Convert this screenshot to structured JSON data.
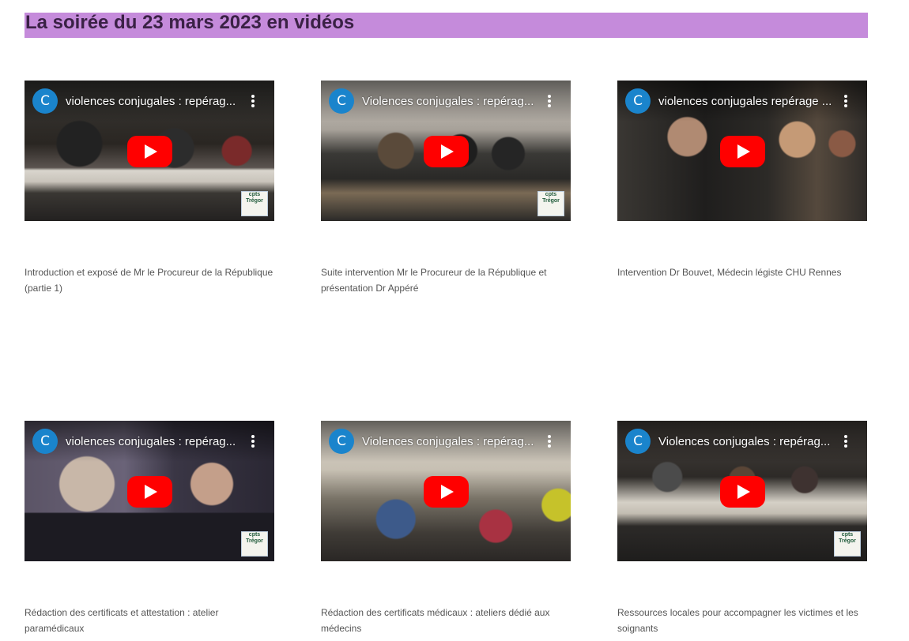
{
  "section": {
    "title": "La soirée du 23 mars 2023 en vidéos"
  },
  "videos": [
    {
      "title": "violences conjugales : repérag...",
      "channel_initial": "C",
      "logo_text": "cpts Trégor",
      "caption": "Introduction et exposé de Mr le Procureur de la République (partie 1)"
    },
    {
      "title": "Violences conjugales : repérag...",
      "channel_initial": "C",
      "logo_text": "cpts Trégor",
      "caption": "Suite intervention Mr le Procureur de la République et présentation Dr Appéré"
    },
    {
      "title": "violences conjugales repérage ...",
      "channel_initial": "C",
      "logo_text": "",
      "caption": "Intervention Dr Bouvet, Médecin légiste CHU Rennes"
    },
    {
      "title": "violences conjugales : repérag...",
      "channel_initial": "C",
      "logo_text": "cpts Trégor",
      "caption": "Rédaction des certificats et attestation : atelier paramédicaux"
    },
    {
      "title": "Violences conjugales : repérag...",
      "channel_initial": "C",
      "logo_text": "",
      "caption": "Rédaction des certificats médicaux : ateliers dédié aux médecins"
    },
    {
      "title": "Violences conjugales : repérag...",
      "channel_initial": "C",
      "logo_text": "cpts Trégor",
      "caption": "Ressources locales pour accompagner les victimes et les soignants"
    }
  ],
  "colors": {
    "banner": "#c58bdb",
    "play": "#ff0000",
    "channel": "#1a84cc"
  },
  "icons": {
    "play": "play-button-icon",
    "menu": "more-vert-icon"
  }
}
